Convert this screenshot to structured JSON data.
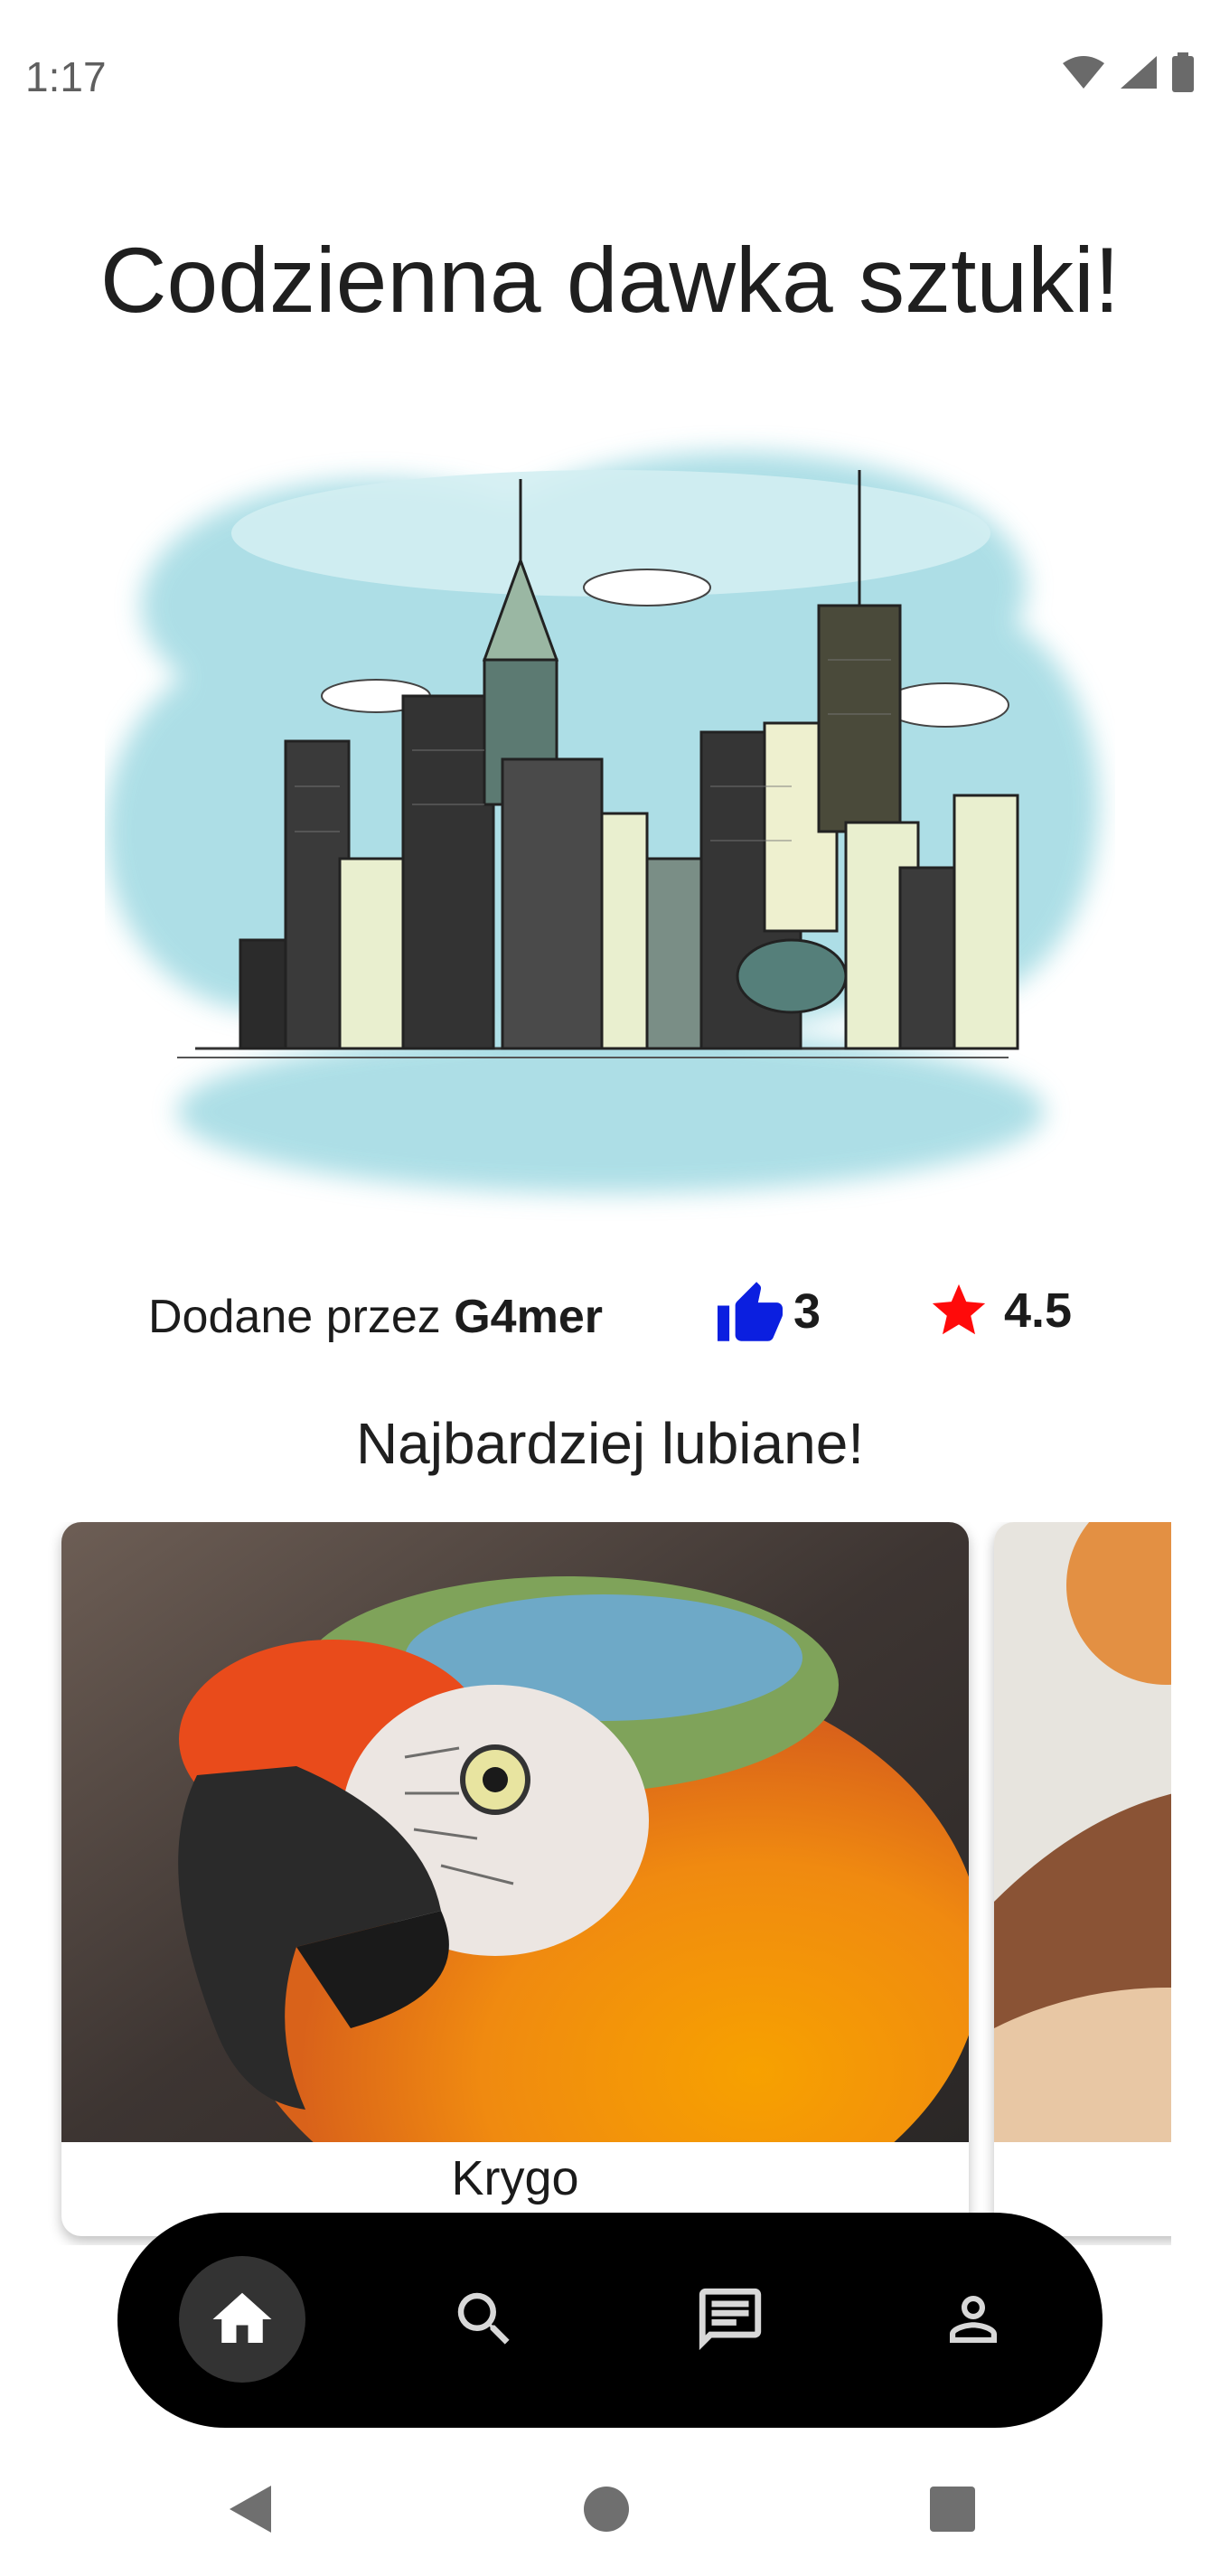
{
  "status_bar": {
    "time": "1:17",
    "icons": [
      "wifi-icon",
      "signal-icon",
      "battery-icon"
    ]
  },
  "headline": "Codzienna dawka sztuki!",
  "featured": {
    "image": "city-skyline-sketch-image",
    "added_by_label": "Dodane przez",
    "author": "G4mer",
    "likes": "3",
    "rating": "4.5"
  },
  "section_title": "Najbardziej lubiane!",
  "cards": [
    {
      "label": "Krygo",
      "image": "parrot-photo"
    },
    {
      "label": "",
      "image": "abstract-shapes-art"
    }
  ],
  "bottom_nav": {
    "items": [
      "home-icon",
      "search-icon",
      "chat-icon",
      "profile-icon"
    ],
    "active": "home"
  },
  "colors": {
    "like_blue": "#0b1fe0",
    "star_red": "#ff0a0a",
    "nav_bg": "#000000",
    "nav_active": "#333333"
  }
}
